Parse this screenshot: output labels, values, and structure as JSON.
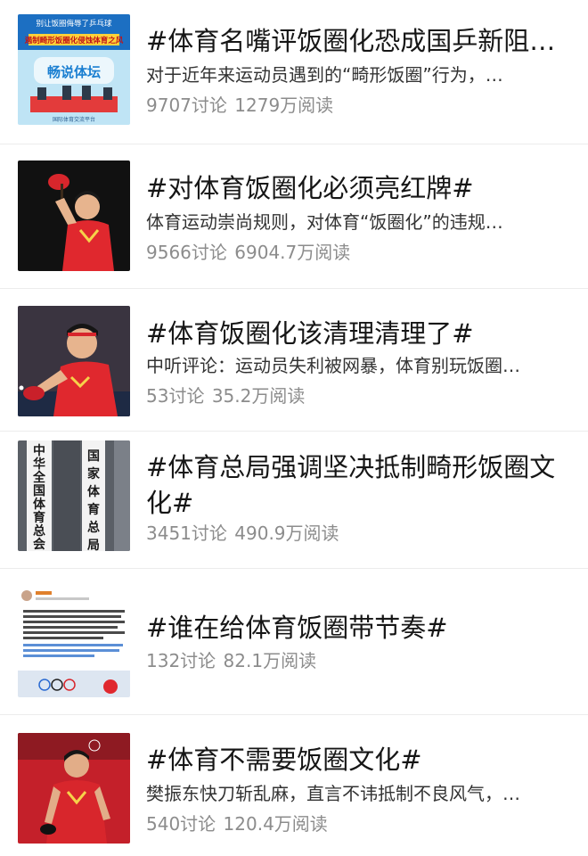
{
  "topics": [
    {
      "title": "#体育名嘴评饭圈化恐成国乒新阻…",
      "desc": "对于近年来运动员遇到的“畸形饭圈”行为，…",
      "discussions": "9707讨论",
      "reads": "1279万阅读",
      "thumb_icon": "tv-studio-image",
      "thumb_text": [
        "别让饭圈侮辱了乒乓球",
        "遏制畸形饭圈化侵蚀体育之风",
        "畅说体坛",
        "国际体育交流平台"
      ]
    },
    {
      "title": "#对体育饭圈化必须亮红牌#",
      "desc": "体育运动崇尚规则，对体育“饭圈化”的违规…",
      "discussions": "9566讨论",
      "reads": "6904.7万阅读",
      "thumb_icon": "table-tennis-player-image",
      "thumb_text": []
    },
    {
      "title": "#体育饭圈化该清理清理了#",
      "desc": "中听评论：运动员失利被网暴，体育别玩饭圈…",
      "discussions": "53讨论",
      "reads": "35.2万阅读",
      "thumb_icon": "table-tennis-player-image",
      "thumb_text": []
    },
    {
      "title": "#体育总局强调坚决抵制畸形饭圈文化#",
      "desc": "",
      "discussions": "3451讨论",
      "reads": "490.9万阅读",
      "thumb_icon": "building-signboard-image",
      "thumb_text": [
        "中华全国体育总会",
        "国家体育总局"
      ]
    },
    {
      "title": "#谁在给体育饭圈带节奏#",
      "desc": "",
      "discussions": "132讨论",
      "reads": "82.1万阅读",
      "thumb_icon": "weibo-post-screenshot-image",
      "thumb_text": []
    },
    {
      "title": "#体育不需要饭圈文化#",
      "desc": "樊振东快刀斩乱麻，直言不讳抵制不良风气，…",
      "discussions": "540讨论",
      "reads": "120.4万阅读",
      "thumb_icon": "table-tennis-player-image",
      "thumb_text": []
    }
  ],
  "colors": {
    "title": "#161616",
    "desc": "#333333",
    "stats": "#8c8c8c",
    "divider": "#ececec",
    "china_red": "#d71f26"
  }
}
